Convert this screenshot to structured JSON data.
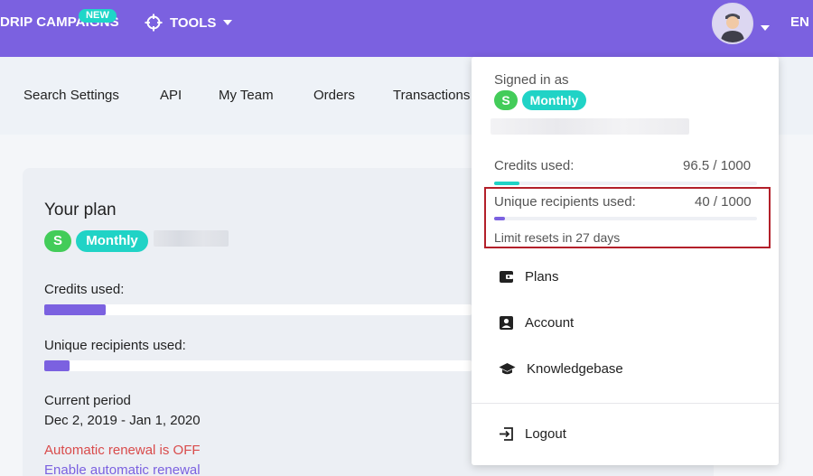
{
  "topnav": {
    "drip_label": "DRIP CAMPAIGNS",
    "new_badge": "NEW",
    "tools_label": "TOOLS",
    "lang_label": "EN"
  },
  "subnav": {
    "items": [
      "Search Settings",
      "API",
      "My Team",
      "Orders",
      "Transactions"
    ]
  },
  "plan": {
    "title": "Your plan",
    "badge_s": "S",
    "badge_monthly": "Monthly",
    "credits_label": "Credits used:",
    "credits_fill_fraction": 0.0965,
    "recipients_label": "Unique recipients used:",
    "recipients_fill_fraction": 0.04,
    "period_label": "Current period",
    "period_value": "Dec 2, 2019 - Jan 1, 2020",
    "renewal_status": "Automatic renewal is OFF",
    "renewal_link": "Enable automatic renewal"
  },
  "dropdown": {
    "signed_in_as": "Signed in as",
    "badge_s": "S",
    "badge_monthly": "Monthly",
    "credits_label": "Credits used:",
    "credits_value": "96.5 / 1000",
    "credits_fill_fraction": 0.0965,
    "recipients_label": "Unique recipients used:",
    "recipients_value": "40 / 1000",
    "recipients_fill_fraction": 0.04,
    "limit_reset": "Limit resets in 27 days",
    "menu": {
      "plans": "Plans",
      "account": "Account",
      "knowledgebase": "Knowledgebase",
      "logout": "Logout"
    }
  },
  "colors": {
    "primary": "#7b61e0",
    "teal": "#20d3c6",
    "green": "#43cc59",
    "red": "#d94b4b"
  }
}
